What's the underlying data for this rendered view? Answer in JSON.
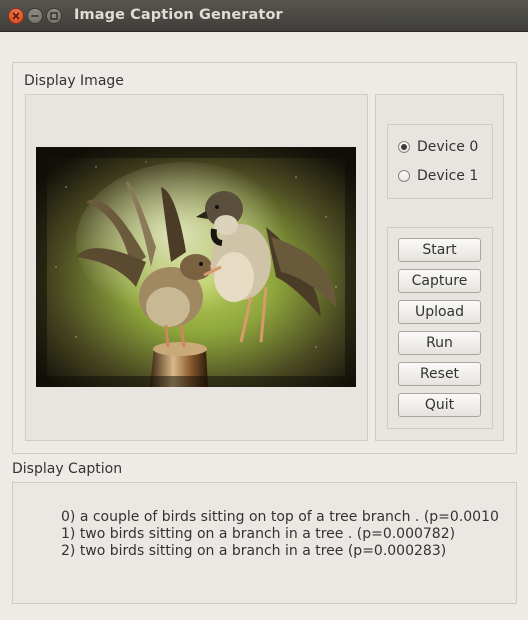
{
  "window": {
    "title": "Image Caption Generator",
    "controls": [
      {
        "name": "close",
        "icon": "close-icon"
      },
      {
        "name": "minimize",
        "icon": "minimize-icon"
      },
      {
        "name": "maximize",
        "icon": "maximize-icon"
      }
    ]
  },
  "display_image": {
    "group_title": "Display Image",
    "image_description_icon": "photo-two-sparrows"
  },
  "devices": {
    "options": [
      "Device 0",
      "Device 1"
    ],
    "selected": "Device 0"
  },
  "buttons": {
    "start": "Start",
    "capture": "Capture",
    "upload": "Upload",
    "run": "Run",
    "reset": "Reset",
    "quit": "Quit"
  },
  "display_caption": {
    "group_title": "Display Caption",
    "lines": [
      "0) a couple of birds sitting on top of a tree branch . (p=0.0010",
      "1) two birds sitting on a branch in a tree . (p=0.000782)",
      "2) two birds sitting on a branch in a tree (p=0.000283)"
    ]
  },
  "colors": {
    "window_bg": "#eeebe7",
    "titlebar_bg": "#3f3e3a",
    "close_button": "#e05a2b",
    "title_text": "#e0dcd6"
  }
}
